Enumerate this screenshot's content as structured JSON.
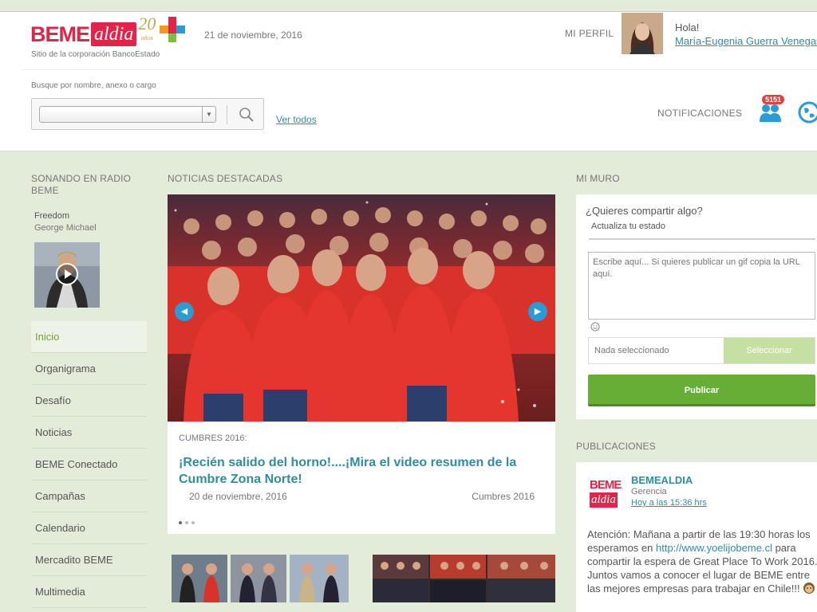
{
  "header": {
    "logo_beme": "BEME",
    "logo_aldia": "aldia",
    "logo_20": "20",
    "logo_anos": "años",
    "tagline": "Sitio de la corporación BancoEstado",
    "date": "21 de noviembre, 2016",
    "profile_link": "MI PERFIL",
    "greeting": "Hola!",
    "user_name": "María-Eugenia Guerra Venegas",
    "search_label": "Busque por nombre, anexo o cargo",
    "ver_todos": "Ver todos",
    "notifications_label": "NOTIFICACIONES",
    "notifications_count": "5151"
  },
  "radio": {
    "title": "SONANDO EN RADIO BEME",
    "song": "Freedom",
    "artist": "George Michael"
  },
  "menu": {
    "items": [
      {
        "label": "Inicio"
      },
      {
        "label": "Organigrama"
      },
      {
        "label": "Desafío"
      },
      {
        "label": "Noticias"
      },
      {
        "label": "BEME Conectado"
      },
      {
        "label": "Campañas"
      },
      {
        "label": "Calendario"
      },
      {
        "label": "Mercadito BEME"
      },
      {
        "label": "Multimedia"
      }
    ]
  },
  "news": {
    "section_title": "NOTICIAS DESTACADAS",
    "category": "CUMBRES 2016:",
    "headline": "¡Recién salido del horno!....¡Mira el video resumen de la Cumbre Zona Norte!",
    "date": "20 de noviembre, 2016",
    "tag": "Cumbres 2016"
  },
  "wall": {
    "title": "MI MURO",
    "question": "¿Quieres compartir algo?",
    "tab": "Actualiza tu estado",
    "placeholder": "Escribe aquí... Si quieres publicar un gif copia la URL aquí.",
    "file_text": "Nada seleccionado",
    "select_button": "Seleccionar",
    "publish_button": "Publicar"
  },
  "publications": {
    "title": "PUBLICACIONES",
    "logo_beme": "BEME",
    "logo_aldia": "aldia",
    "author": "BEMEALDIA",
    "role": "Gerencia",
    "time": "Hoy a las 15:36 hrs",
    "body_pre": "Atención: Mañana a partir de las 19:30 horas los esperamos en ",
    "link": "http://www.yoelijobeme.cl",
    "body_post": " para compartir la espera de Great Place To Work 2016. Juntos vamos a conocer el lugar de BEME entre las mejores empresas para trabajar en Chile!!!"
  },
  "colors": {
    "brand_red": "#e4234b",
    "link_teal": "#2e8ea0",
    "active_green": "#7a9b3a",
    "publish_green": "#67ae36",
    "page_bg": "#e3ecd9"
  }
}
